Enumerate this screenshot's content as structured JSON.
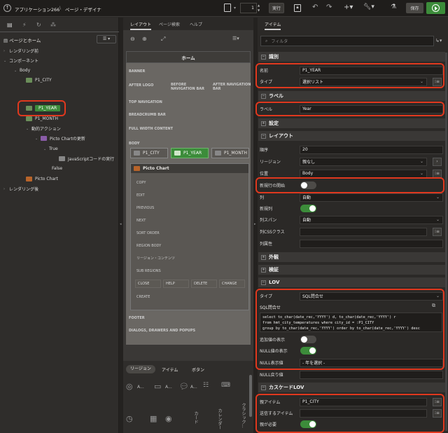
{
  "app": {
    "breadcrumb_app": "アプリケーション266",
    "breadcrumb_page": "ページ・デザイナ",
    "page_number": "1",
    "run_label": "実行",
    "save_label": "保存",
    "accent": "#3c8c3a",
    "highlight": "#e0381e"
  },
  "left": {
    "filter_placeholder": "",
    "header": "ページとホーム",
    "tree": [
      "レンダリング前",
      "コンポーネント",
      "Body",
      "P1_CITY",
      "P1_YEAR",
      "P1_MONTH",
      "動的アクション",
      "Picto Chartの更新",
      "True",
      "JavaScriptコードの実行",
      "False",
      "Picto Chart",
      "レンダリング後"
    ]
  },
  "middle": {
    "tabs": [
      "レイアウト",
      "ページ検索",
      "ヘルプ"
    ],
    "home": "ホーム",
    "slots": [
      "BANNER",
      "AFTER LOGO",
      "BEFORE NAVIGATION BAR",
      "AFTER NAVIGATION BAR",
      "TOP NAVIGATION",
      "BREADCRUMB BAR",
      "FULL WIDTH CONTENT",
      "BODY",
      "FOOTER",
      "DIALOGS, DRAWERS AND POPUPS"
    ],
    "items": [
      "P1_CITY",
      "P1_YEAR",
      "P1_MONTH"
    ],
    "region_title": "Picto Chart",
    "region_slots": [
      "COPY",
      "EDIT",
      "PREVIOUS",
      "NEXT",
      "SORT ORDER",
      "REGION BODY",
      "リージョン・コンテンツ",
      "SUB REGIONS"
    ],
    "buttons": [
      "CLOSE",
      "HELP",
      "DELETE",
      "CHANGE",
      "CREATE"
    ],
    "gallery_tabs": [
      "リージョン",
      "アイテム",
      "ボタン"
    ],
    "gallery_labels": [
      "A...",
      "A...",
      "A...",
      "カード",
      "カレンダー",
      "クラシック..."
    ]
  },
  "right": {
    "tab": "アイテム",
    "filter_placeholder": "フィルタ",
    "sections": {
      "id": "識別",
      "label": "ラベル",
      "settings": "設定",
      "layout": "レイアウト",
      "appearance": "外観",
      "validation": "検証",
      "lov": "LOV",
      "cascade": "カスケードLOV"
    },
    "props": {
      "name_label": "名前",
      "name_value": "P1_YEAR",
      "type_label": "タイプ",
      "type_value": "選択リスト",
      "label_label": "ラベル",
      "label_value": "Year",
      "seq_label": "順序",
      "seq_value": "20",
      "region_label": "リージョン",
      "region_value": "親なし",
      "position_label": "位置",
      "position_value": "Body",
      "newrow_label": "新規行の開始",
      "newrow_on": false,
      "col_label": "列",
      "col_value": "自動",
      "newcol_label": "新規列",
      "newcol_on": true,
      "colspan_label": "列スパン",
      "colspan_value": "自動",
      "colcss_label": "列CSSクラス",
      "colattr_label": "列属性",
      "lovtype_label": "タイプ",
      "lovtype_value": "SQL問合せ",
      "sql_label": "SQL問合せ",
      "sql_lines": [
        "select to_char(date_rec,'YYYY') d, to_char(date_rec,'YYYY') r",
        "from hmt_city_temperatures where city_id = :P1_CITY",
        "group by to_char(date_rec,'YYYY') order by to_char(date_rec,'YYYY') desc"
      ],
      "extra_label": "追加値の表示",
      "extra_on": false,
      "null_label": "NULL値の表示",
      "null_on": true,
      "nulldisp_label": "NULL表示値",
      "nulldisp_value": "- 年を選択 -",
      "nullret_label": "NULL戻り値",
      "parent_label": "親アイテム",
      "parent_value": "P1_CITY",
      "submit_label": "送信するアイテム",
      "parentreq_label": "親が必要",
      "parentreq_on": true
    }
  }
}
